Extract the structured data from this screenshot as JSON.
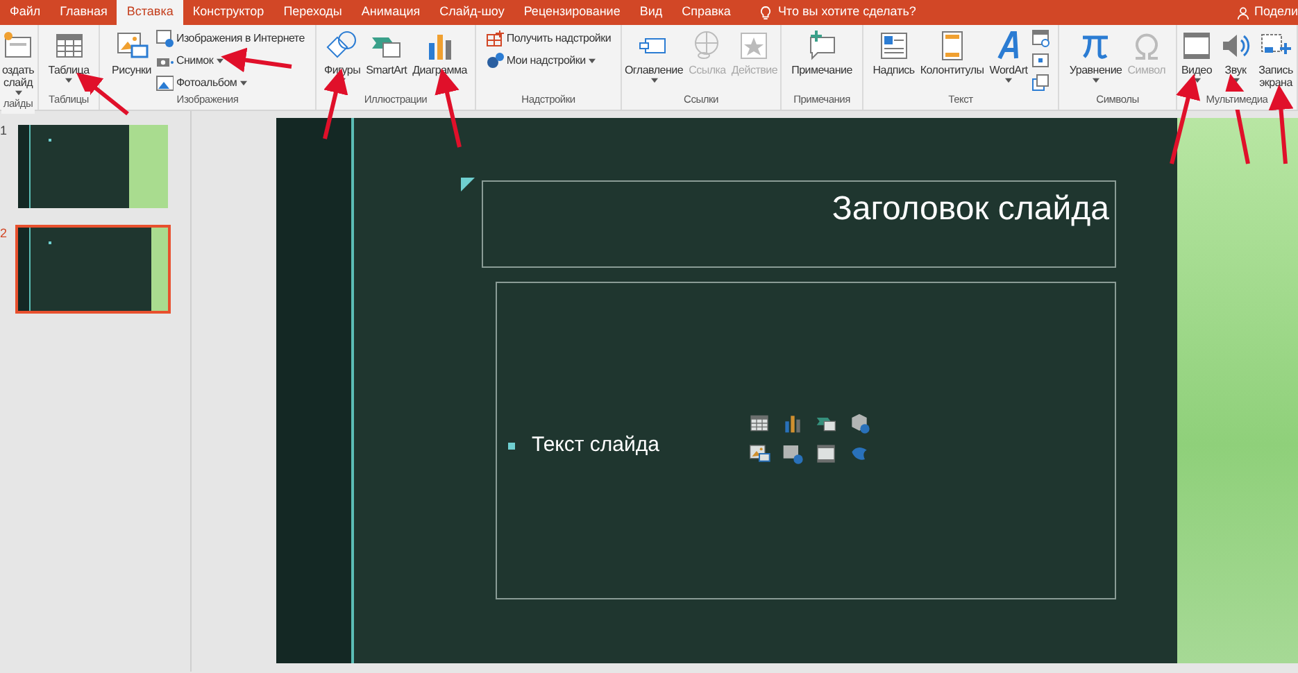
{
  "tabs": [
    {
      "label": "Файл",
      "selected": false
    },
    {
      "label": "Главная",
      "selected": false
    },
    {
      "label": "Вставка",
      "selected": true
    },
    {
      "label": "Конструктор",
      "selected": false
    },
    {
      "label": "Переходы",
      "selected": false
    },
    {
      "label": "Анимация",
      "selected": false
    },
    {
      "label": "Слайд-шоу",
      "selected": false
    },
    {
      "label": "Рецензирование",
      "selected": false
    },
    {
      "label": "Вид",
      "selected": false
    },
    {
      "label": "Справка",
      "selected": false
    }
  ],
  "tell_me": {
    "placeholder": "Что вы хотите сделать?"
  },
  "share": {
    "label": "Подели"
  },
  "ribbon_groups": [
    {
      "label": "лайды",
      "items": [
        {
          "kind": "large",
          "label": "оздать слайд",
          "dropdown": true,
          "disabled": false
        }
      ]
    },
    {
      "label": "Таблицы",
      "items": [
        {
          "kind": "large",
          "label": "Таблица",
          "dropdown": true,
          "disabled": false
        }
      ]
    },
    {
      "label": "Изображения",
      "items": [
        {
          "kind": "large",
          "label": "Рисунки",
          "dropdown": false,
          "disabled": false
        },
        {
          "kind": "small",
          "label": "Изображения в Интернете",
          "dropdown": false,
          "disabled": false
        },
        {
          "kind": "small",
          "label": "Снимок",
          "dropdown": true,
          "disabled": false
        },
        {
          "kind": "small",
          "label": "Фотоальбом",
          "dropdown": true,
          "disabled": false
        }
      ]
    },
    {
      "label": "Иллюстрации",
      "items": [
        {
          "kind": "large",
          "label": "Фигуры",
          "dropdown": true,
          "disabled": false
        },
        {
          "kind": "large",
          "label": "SmartArt",
          "dropdown": false,
          "disabled": false
        },
        {
          "kind": "large",
          "label": "Диаграмма",
          "dropdown": false,
          "disabled": false
        }
      ]
    },
    {
      "label": "Надстройки",
      "items": [
        {
          "kind": "small",
          "label": "Получить надстройки",
          "dropdown": false,
          "disabled": false
        },
        {
          "kind": "small",
          "label": "Мои надстройки",
          "dropdown": true,
          "disabled": false
        }
      ]
    },
    {
      "label": "Ссылки",
      "items": [
        {
          "kind": "large",
          "label": "Оглавление",
          "dropdown": true,
          "disabled": false
        },
        {
          "kind": "large",
          "label": "Ссылка",
          "dropdown": false,
          "disabled": true
        },
        {
          "kind": "large",
          "label": "Действие",
          "dropdown": false,
          "disabled": true
        }
      ]
    },
    {
      "label": "Примечания",
      "items": [
        {
          "kind": "large",
          "label": "Примечание",
          "dropdown": false,
          "disabled": false
        }
      ]
    },
    {
      "label": "Текст",
      "items": [
        {
          "kind": "large",
          "label": "Надпись",
          "dropdown": false,
          "disabled": false
        },
        {
          "kind": "large",
          "label": "Колонтитулы",
          "dropdown": false,
          "disabled": false
        },
        {
          "kind": "large",
          "label": "WordArt",
          "dropdown": true,
          "disabled": false
        },
        {
          "kind": "icon",
          "dropdown": false,
          "disabled": false
        },
        {
          "kind": "icon",
          "dropdown": false,
          "disabled": false
        },
        {
          "kind": "icon",
          "dropdown": false,
          "disabled": false
        }
      ]
    },
    {
      "label": "Символы",
      "items": [
        {
          "kind": "large",
          "label": "Уравнение",
          "dropdown": true,
          "disabled": false
        },
        {
          "kind": "large",
          "label": "Символ",
          "dropdown": false,
          "disabled": true
        }
      ]
    },
    {
      "label": "Мультимедиа",
      "items": [
        {
          "kind": "large",
          "label": "Видео",
          "dropdown": true,
          "disabled": false
        },
        {
          "kind": "large",
          "label": "Звук",
          "dropdown": true,
          "disabled": false
        },
        {
          "kind": "large",
          "label": "Запись экрана",
          "dropdown": false,
          "disabled": false
        }
      ]
    }
  ],
  "slides": [
    {
      "number": "1",
      "selected": false
    },
    {
      "number": "2",
      "selected": true
    }
  ],
  "slide": {
    "title": "Заголовок слайда",
    "bullets": [
      "Текст слайда"
    ]
  }
}
